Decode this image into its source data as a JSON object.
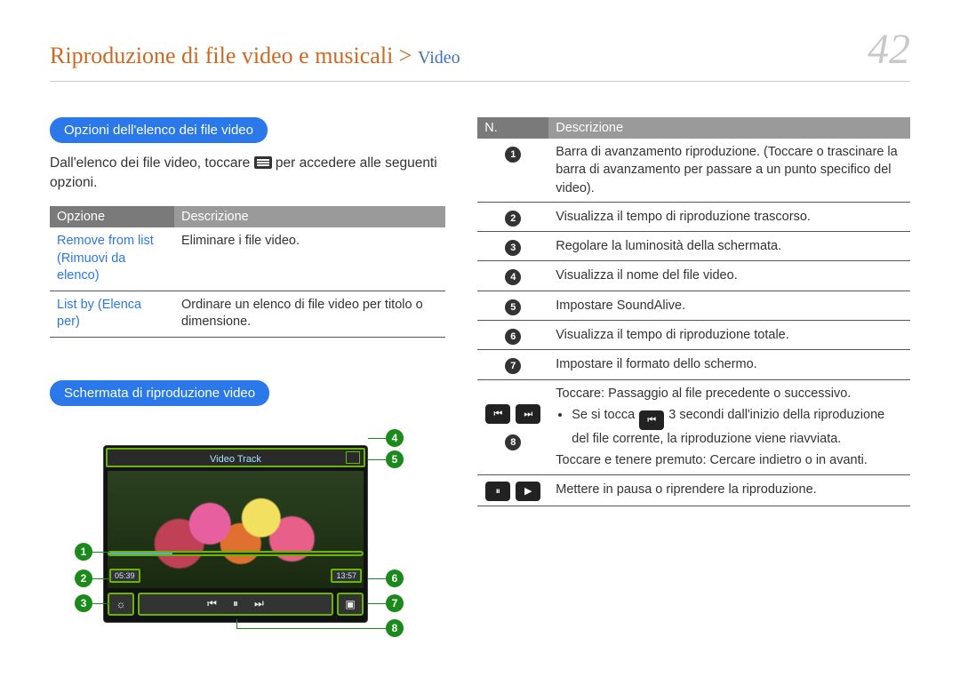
{
  "header": {
    "breadcrumb_main": "Riproduzione di file video e musicali > ",
    "breadcrumb_sub": "Video",
    "page_number": "42"
  },
  "section1": {
    "title": "Opzioni dell'elenco dei file video",
    "intro_before": "Dall'elenco dei file video, toccare ",
    "intro_after": " per accedere alle seguenti opzioni.",
    "th_option": "Opzione",
    "th_desc": "Descrizione",
    "rows": [
      {
        "opt": "Remove from list (Rimuovi da elenco)",
        "desc": "Eliminare i file video."
      },
      {
        "opt": "List by (Elenca per)",
        "desc": "Ordinare un elenco di file video per titolo o dimensione."
      }
    ]
  },
  "section2": {
    "title": "Schermata di riproduzione video",
    "player_title": "Video Track",
    "time_elapsed": "05:39",
    "time_total": "13:57"
  },
  "desc_table": {
    "th_n": "N.",
    "th_desc": "Descrizione",
    "rows": [
      {
        "n": "1",
        "text": "Barra di avanzamento riproduzione. (Toccare o trascinare la barra di avanzamento per passare a un punto specifico del video)."
      },
      {
        "n": "2",
        "text": "Visualizza il tempo di riproduzione trascorso."
      },
      {
        "n": "3",
        "text": "Regolare la luminosità della schermata."
      },
      {
        "n": "4",
        "text": "Visualizza il nome del file video."
      },
      {
        "n": "5",
        "text": "Impostare SoundAlive."
      },
      {
        "n": "6",
        "text": "Visualizza il tempo di riproduzione totale."
      },
      {
        "n": "7",
        "text": "Impostare il formato dello schermo."
      }
    ],
    "row8": {
      "n": "8",
      "line1": "Toccare: Passaggio al file precedente o successivo.",
      "bullet_before": "Se si tocca ",
      "bullet_after": " 3 secondi dall'inizio della riproduzione del file corrente, la riproduzione viene riavviata.",
      "line3": "Toccare e tenere premuto: Cercare indietro o in avanti."
    },
    "row9": {
      "text": "Mettere in pausa o riprendere la riproduzione."
    }
  },
  "callouts": {
    "c1": "1",
    "c2": "2",
    "c3": "3",
    "c4": "4",
    "c5": "5",
    "c6": "6",
    "c7": "7",
    "c8": "8"
  }
}
